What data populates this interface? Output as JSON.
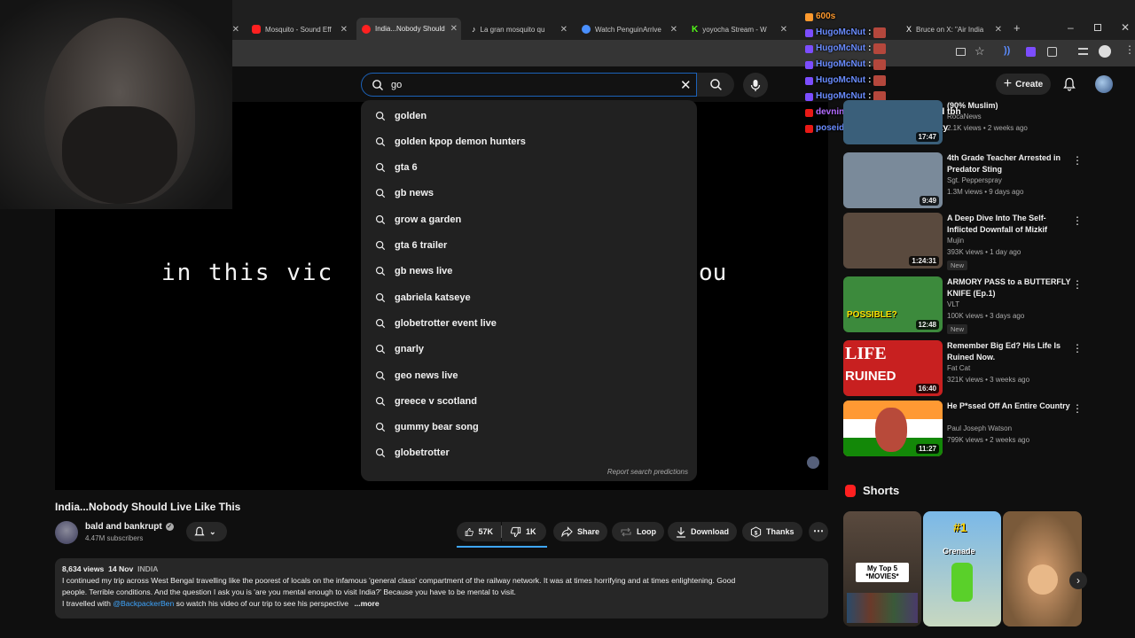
{
  "browser": {
    "tabs": [
      {
        "label": "Mosquito - Sound Eff",
        "favicon_color": "#ff2020"
      },
      {
        "label": "India...Nobody Should",
        "favicon_color": "#ff2020",
        "active": true
      },
      {
        "label": "La gran mosquito qu",
        "favicon_color": "#25f4ee"
      },
      {
        "label": "Watch PenguinArrive",
        "favicon_color": "#4a90ff"
      },
      {
        "label": "yoyocha Stream - W",
        "favicon_color": "#8bd34a"
      },
      {
        "label": "Bruce on X: \"Air India",
        "favicon_color": "#ffffff"
      }
    ],
    "new_tab": "+"
  },
  "chat": [
    {
      "user": "600s",
      "msg": "",
      "color": "#ff9a2e",
      "badge": "#ff9a2e"
    },
    {
      "user": "HugoMcNut",
      "msg": ":",
      "color": "#6a8cff",
      "badge": "#7c4dff"
    },
    {
      "user": "HugoMcNut",
      "msg": ":",
      "color": "#6a8cff",
      "badge": "#7c4dff"
    },
    {
      "user": "HugoMcNut",
      "msg": ":",
      "color": "#6a8cff",
      "badge": "#7c4dff"
    },
    {
      "user": "HugoMcNut",
      "msg": ":",
      "color": "#6a8cff",
      "badge": "#7c4dff"
    },
    {
      "user": "HugoMcNut",
      "msg": ":",
      "color": "#6a8cff",
      "badge": "#7c4dff"
    },
    {
      "user": "devnin",
      "msg": ": most of them look old tbh",
      "color": "#b36bff",
      "badge": "#e91916"
    },
    {
      "user": "poseidon_07",
      "msg": ": low trust society",
      "color": "#6a8cff",
      "badge": "#e91916"
    }
  ],
  "search": {
    "value": "go",
    "suggestions": [
      "golden",
      "golden kpop demon hunters",
      "gta 6",
      "gb news",
      "grow a garden",
      "gta 6 trailer",
      "gb news live",
      "gabriela katseye",
      "globetrotter event live",
      "gnarly",
      "geo news live",
      "greece v scotland",
      "gummy bear song",
      "globetrotter"
    ],
    "report_label": "Report search predictions"
  },
  "header": {
    "create_label": "Create"
  },
  "video": {
    "caption_left": "in this vic",
    "caption_right": "ou",
    "title": "India...Nobody Should Live Like This",
    "channel": "bald and bankrupt",
    "subscribers": "4.47M subscribers",
    "likes": "57K",
    "dislikes": "1K",
    "share": "Share",
    "loop": "Loop",
    "download": "Download",
    "thanks": "Thanks"
  },
  "description": {
    "views": "8,634 views",
    "date": "14 Nov",
    "tag": "INDIA",
    "line1": "I continued my trip across West Bengal travelling like the poorest of locals on the infamous 'general class' compartment of the railway network. It was at times horrifying and at times enlightening. Good",
    "line2": "people. Terrible conditions. And the question I ask you is 'are you mental enough to visit India?' Because you have to be mental to visit.",
    "line3_prefix": "I travelled with",
    "line3_link": "@BackpackerBen",
    "line3_suffix": "so watch his video of our trip to see his perspective",
    "more": "...more"
  },
  "recommendations": [
    {
      "title": "(90% Muslim)",
      "channel": "RocaNews",
      "meta": "2.1K views • 2 weeks ago",
      "duration": "17:47",
      "thumb": "#3a5f7a",
      "new": ""
    },
    {
      "title": "4th Grade Teacher Arrested in Predator Sting",
      "channel": "Sgt. Pepperspray",
      "meta": "1.3M views • 9 days ago",
      "duration": "9:49",
      "thumb": "#7a8a9a",
      "new": ""
    },
    {
      "title": "A Deep Dive Into The Self-Inflicted Downfall of Mizkif",
      "channel": "Mujin",
      "meta": "393K views • 1 day ago",
      "duration": "1:24:31",
      "thumb": "#5a4a3e",
      "new": "New"
    },
    {
      "title": "ARMORY PASS to a BUTTERFLY KNIFE (Ep.1)",
      "channel": "VLT",
      "meta": "100K views • 3 days ago",
      "duration": "12:48",
      "thumb": "#3c8a3c",
      "new": "New"
    },
    {
      "title": "Remember Big Ed? His Life Is Ruined Now.",
      "channel": "Fat Cat",
      "meta": "321K views • 3 weeks ago",
      "duration": "16:40",
      "thumb": "#c82020",
      "new": ""
    },
    {
      "title": "He P*ssed Off An Entire Country",
      "channel": "Paul Joseph Watson",
      "meta": "799K views • 2 weeks ago",
      "duration": "11:27",
      "thumb": "#e8862a",
      "new": ""
    }
  ],
  "thumb_text": {
    "possible": "POSSIBLE?",
    "life": "LIFE",
    "ruined": "RUINED"
  },
  "shorts": {
    "title": "Shorts",
    "items": [
      {
        "label": "My Top 5 *MOVIES*",
        "color": "#4a4036"
      },
      {
        "label": "Grenade",
        "badge": "#1",
        "color": "#5a9ad0"
      },
      {
        "label": "",
        "color": "#9a7a5a"
      }
    ]
  }
}
